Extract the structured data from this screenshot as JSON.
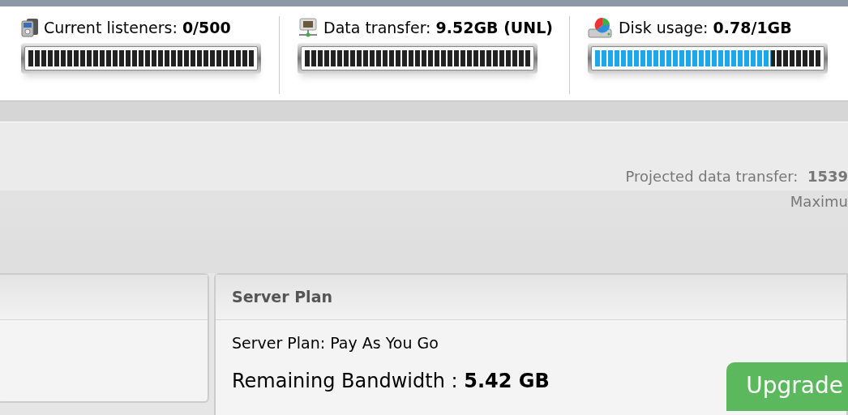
{
  "stats": [
    {
      "kind": "listeners",
      "label": "Current listeners:",
      "value": "0/500"
    },
    {
      "kind": "transfer",
      "label": "Data transfer:",
      "value": "9.52GB (UNL)"
    },
    {
      "kind": "disk",
      "label": "Disk usage:",
      "value": "0.78/1GB",
      "level": 0.78
    }
  ],
  "projected": {
    "label": "Projected data transfer:",
    "value": "1539"
  },
  "maximum_label": "Maximu",
  "server_plan": {
    "title": "Server Plan",
    "plan_text": "Server Plan: Pay As You Go",
    "remaining_label": "Remaining Bandwidth :",
    "remaining_value": "5.42 GB",
    "upgrade_button": "Upgrade"
  }
}
